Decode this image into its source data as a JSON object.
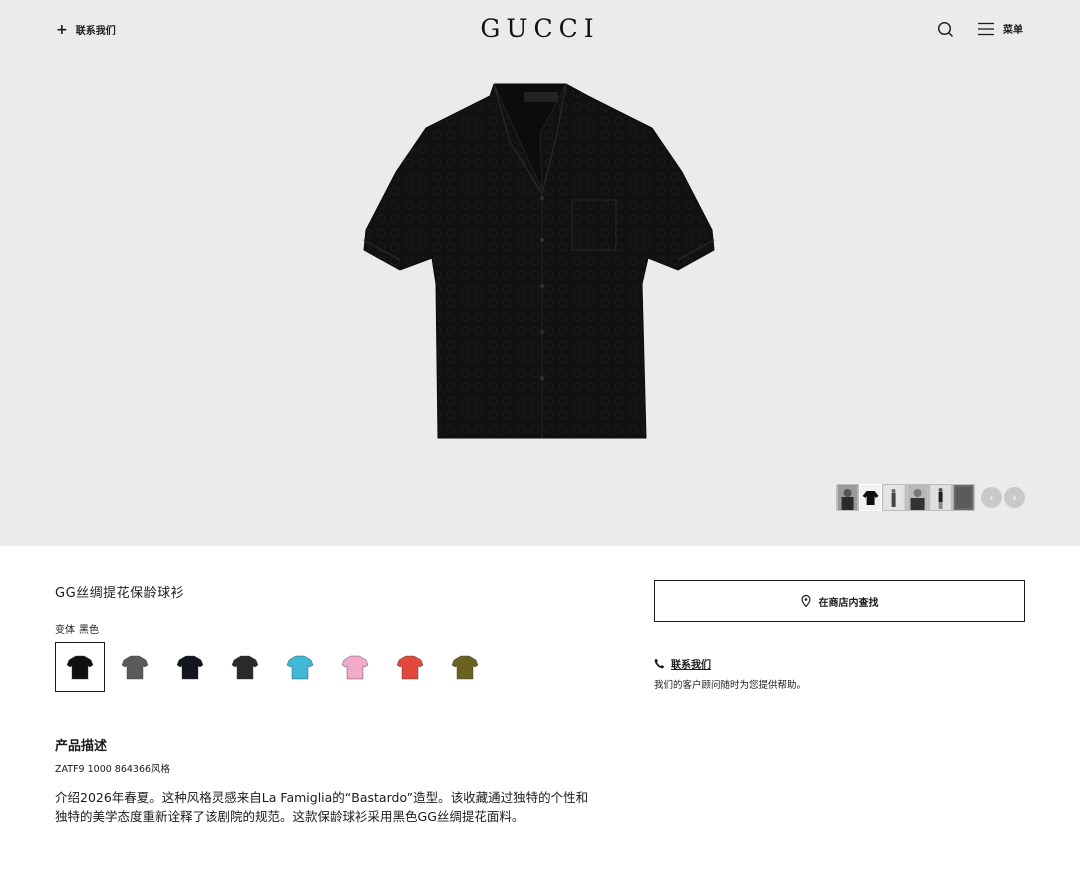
{
  "header": {
    "contact_label": "联系我们",
    "logo": "GUCCI",
    "menu_label": "菜单",
    "contact_icon": "plus-icon",
    "search_icon": "search-icon",
    "menu_icon": "hamburger-icon"
  },
  "gallery": {
    "thumbnail_count": 6,
    "active_thumbnail": 2,
    "prev_icon": "chevron-left-icon",
    "next_icon": "chevron-right-icon",
    "prev_glyph": "‹",
    "next_glyph": "›"
  },
  "product": {
    "title": "GG丝绸提花保龄球衫",
    "variant_label": "变体",
    "variant_value": "黑色",
    "swatches": [
      {
        "color": "#111111",
        "selected": true
      },
      {
        "color": "#5a5a5a",
        "selected": false
      },
      {
        "color": "#14161f",
        "selected": false
      },
      {
        "color": "#2b2b2b",
        "selected": false
      },
      {
        "color": "#3fb8d8",
        "selected": false
      },
      {
        "color": "#f3a9c9",
        "selected": false
      },
      {
        "color": "#e1473a",
        "selected": false
      },
      {
        "color": "#6b6220",
        "selected": false
      }
    ]
  },
  "description": {
    "heading": "产品描述",
    "style_code": "ZATF9 1000 864366风格",
    "text": "介绍2026年春夏。这种风格灵感来自La Famiglia的“Bastardo”造型。该收藏通过独特的个性和独特的美学态度重新诠释了该剧院的规范。这款保龄球衫采用黑色GG丝绸提花面料。"
  },
  "sidebar": {
    "store_button_label": "在商店内查找",
    "store_icon": "map-pin-icon",
    "contact_label": "联系我们",
    "contact_icon": "phone-icon",
    "help_text": "我们的客户顾问随时为您提供帮助。"
  },
  "colors": {
    "hero_background": "#ebebeb",
    "text": "#1b1b1b",
    "shirt": "#111111"
  }
}
